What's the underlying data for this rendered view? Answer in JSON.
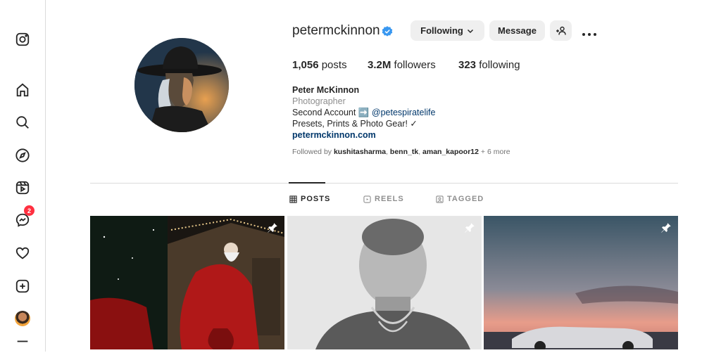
{
  "sidebar": {
    "items": [
      {
        "name": "instagram-logo-icon"
      },
      {
        "name": "home-icon"
      },
      {
        "name": "search-icon"
      },
      {
        "name": "explore-icon"
      },
      {
        "name": "reels-icon"
      },
      {
        "name": "messenger-icon",
        "badge": "2"
      },
      {
        "name": "notifications-heart-icon"
      },
      {
        "name": "create-icon"
      },
      {
        "name": "profile-avatar"
      },
      {
        "name": "more-menu-icon"
      }
    ]
  },
  "profile": {
    "username": "petermckinnon",
    "following_button": "Following",
    "message_button": "Message",
    "stats": {
      "posts_count": "1,056",
      "posts_label": "posts",
      "followers_count": "3.2M",
      "followers_label": "followers",
      "following_count": "323",
      "following_label": "following"
    },
    "bio": {
      "name": "Peter McKinnon",
      "category": "Photographer",
      "line1_text": "Second Account",
      "line1_arrow": "➡️",
      "line1_mention": "@petespiratelife",
      "line2": "Presets, Prints & Photo Gear! ✓",
      "link": "petermckinnon.com"
    },
    "followed_by": {
      "prefix": "Followed by",
      "user1": "kushitasharma",
      "user2": "benn_tk",
      "user3": "aman_kapoor12",
      "more": "+ 6 more"
    }
  },
  "tabs": [
    {
      "label": "POSTS",
      "active": true
    },
    {
      "label": "REELS",
      "active": false
    },
    {
      "label": "TAGGED",
      "active": false
    }
  ],
  "colors": {
    "accent_link": "#00376b",
    "mention": "#00376b",
    "verified": "#0095f6",
    "badge": "#ff3040"
  }
}
